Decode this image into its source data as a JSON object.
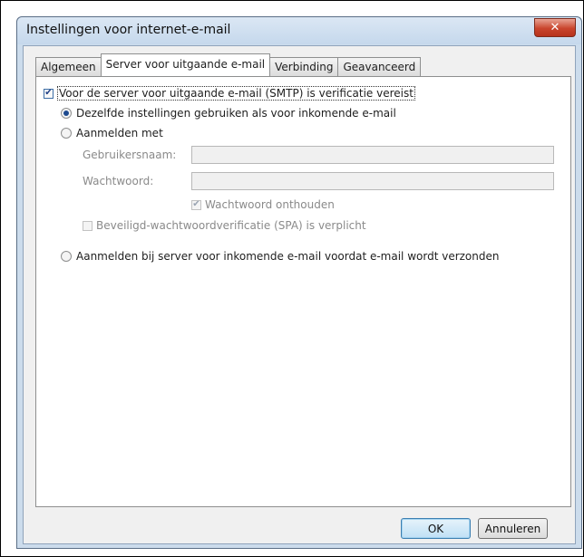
{
  "window": {
    "title": "Instellingen voor internet-e-mail",
    "close_symbol": "✕"
  },
  "tabs": [
    {
      "label": "Algemeen",
      "active": false
    },
    {
      "label": "Server voor uitgaande e-mail",
      "active": true
    },
    {
      "label": "Verbinding",
      "active": false
    },
    {
      "label": "Geavanceerd",
      "active": false
    }
  ],
  "smtp_auth": {
    "label": "Voor de server voor uitgaande e-mail (SMTP) is verificatie vereist",
    "checked": true,
    "check_symbol": "✔"
  },
  "radio_same_settings": {
    "label": "Dezelfde instellingen gebruiken als voor inkomende e-mail",
    "selected": true
  },
  "radio_login_with": {
    "label": "Aanmelden met",
    "selected": false
  },
  "username": {
    "label": "Gebruikersnaam:",
    "value": ""
  },
  "password": {
    "label": "Wachtwoord:",
    "value": ""
  },
  "remember_password": {
    "label": "Wachtwoord onthouden",
    "checked": true,
    "disabled": true,
    "check_symbol": "✔"
  },
  "spa": {
    "label": "Beveiligd-wachtwoordverificatie (SPA) is verplicht",
    "checked": false,
    "disabled": true
  },
  "radio_login_incoming": {
    "label": "Aanmelden bij server voor inkomende e-mail voordat e-mail wordt verzonden",
    "selected": false
  },
  "buttons": {
    "ok": "OK",
    "cancel": "Annuleren"
  },
  "colors": {
    "accent": "#1d4a8f",
    "close_button": "#c9452d",
    "titlebar": "#c5d8ec"
  }
}
